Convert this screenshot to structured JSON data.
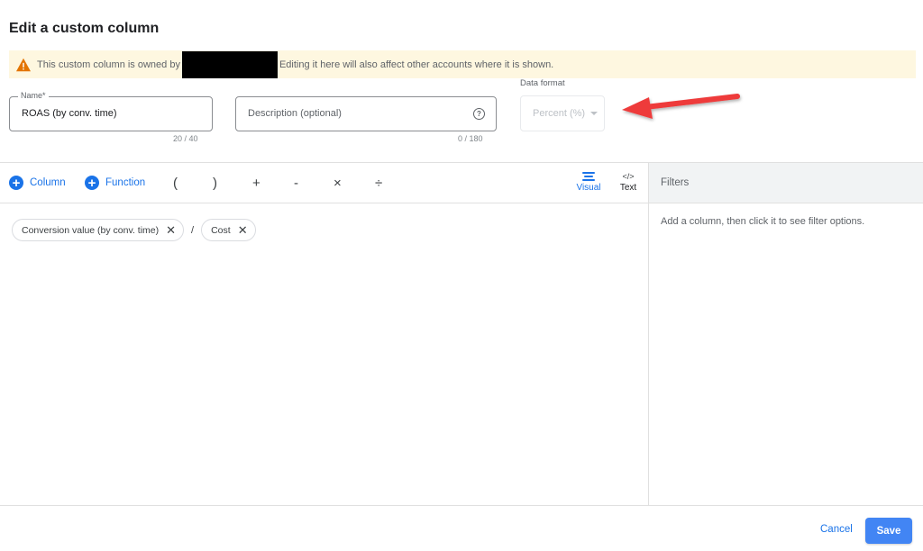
{
  "dialog": {
    "title": "Edit a custom column"
  },
  "banner": {
    "icon": "warning-icon",
    "text_before": "This custom column is owned by",
    "text_after": "Editing it here will also affect other accounts where it is shown."
  },
  "form": {
    "name": {
      "label": "Name*",
      "value": "ROAS (by conv. time)",
      "counter": "20 / 40"
    },
    "description": {
      "placeholder": "Description (optional)",
      "value": "",
      "counter": "0 / 180",
      "help_icon": "help-circle-icon",
      "help_glyph": "?"
    },
    "data_format": {
      "label": "Data format",
      "selected": "Percent (%)"
    }
  },
  "toolbar": {
    "column_label": "Column",
    "function_label": "Function",
    "plus_glyph": "+",
    "operators": [
      "(",
      ")",
      "+",
      "-",
      "×",
      "÷"
    ],
    "modes": [
      {
        "label": "Visual",
        "icon": "visual-lines-icon",
        "active": true
      },
      {
        "label": "Text",
        "icon": "code-icon",
        "glyph": "</>",
        "active": false
      }
    ]
  },
  "formula": {
    "chips": [
      {
        "label": "Conversion value (by conv. time)",
        "remove": "✕"
      },
      {
        "label": "Cost",
        "remove": "✕"
      }
    ],
    "separator": "/"
  },
  "filters": {
    "title": "Filters",
    "hint": "Add a column, then click it to see filter options."
  },
  "footer": {
    "cancel_label": "Cancel",
    "save_label": "Save"
  },
  "colors": {
    "accent": "#1a73e8",
    "save_button": "#4285f4",
    "banner_bg": "#fef7e0",
    "warning": "#e37400",
    "annotation_arrow": "#ee3b3b"
  }
}
